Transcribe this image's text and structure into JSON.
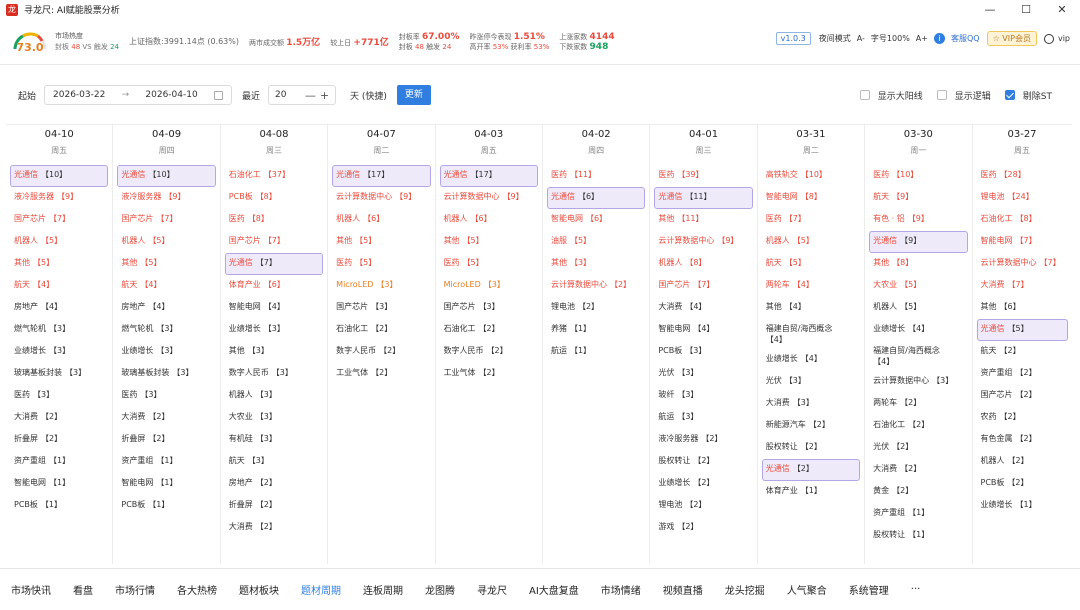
{
  "window": {
    "title": "寻龙尺: AI赋能股票分析",
    "logo": "龙",
    "min": "—",
    "max": "☐",
    "close": "✕"
  },
  "stats": {
    "gauge_value": "73.0",
    "heat_label": "市场热度",
    "heat_line": [
      "封板",
      "48",
      "VS",
      "触发",
      "24"
    ],
    "sh_label": "上证指数:3991.14点 (0.63%)",
    "vol_label": "两市成交额",
    "vol_value": "1.5万亿",
    "prev_label": "较上日",
    "prev_value": "+771亿",
    "seal_rate_label": "封板率",
    "seal_rate": "67.00%",
    "seal_count_label": "封板",
    "seal_count": "48",
    "touch_label": "触发",
    "touch_count": "24",
    "yest_label": "昨涨停今表现",
    "yest_value": "1.51%",
    "open_label": "高开率",
    "open_rate": "53%",
    "profit_label": "获利率",
    "profit_rate": "53%",
    "up_label": "上涨家数",
    "up_count": "4144",
    "down_label": "下跌家数",
    "down_count": "948"
  },
  "toolbar": {
    "version": "v1.0.3",
    "night": "夜间模式",
    "font_minus": "A-",
    "font_label": "字号100%",
    "font_plus": "A+",
    "info": "i",
    "qq": "客服QQ",
    "vip": "☆ VIP会员",
    "user": "vip"
  },
  "filter": {
    "start_label": "起始",
    "date_from": "2026-03-22",
    "arrow": "→",
    "date_to": "2026-04-10",
    "recent_label": "最近",
    "recent_value": "20",
    "minus": "—",
    "plus": "+",
    "days_label": "天 (快捷)",
    "update_btn": "更新",
    "opt_sun": "显示大阳线",
    "opt_logic": "显示逻辑",
    "opt_st": "剔除ST"
  },
  "colors": {
    "red": "#e84c3d",
    "orange": "#e67e22",
    "highlight": "#eeeaf9",
    "accent": "#2f7ee0"
  },
  "columns": [
    {
      "date": "04-10",
      "week": "周五",
      "items": [
        {
          "name": "光通信",
          "count": "【10】",
          "color": "red",
          "hl": true
        },
        {
          "name": "液冷服务器",
          "count": "【9】",
          "color": "red"
        },
        {
          "name": "国产芯片",
          "count": "【7】",
          "color": "red"
        },
        {
          "name": "机器人",
          "count": "【5】",
          "color": "red"
        },
        {
          "name": "其他",
          "count": "【5】",
          "color": "red"
        },
        {
          "name": "航天",
          "count": "【4】",
          "color": "red"
        },
        {
          "name": "房地产",
          "count": "【4】",
          "color": "blk"
        },
        {
          "name": "燃气轮机",
          "count": "【3】",
          "color": "blk"
        },
        {
          "name": "业绩增长",
          "count": "【3】",
          "color": "blk"
        },
        {
          "name": "玻璃基板封装",
          "count": "【3】",
          "color": "blk"
        },
        {
          "name": "医药",
          "count": "【3】",
          "color": "blk"
        },
        {
          "name": "大消费",
          "count": "【2】",
          "color": "blk"
        },
        {
          "name": "折叠屏",
          "count": "【2】",
          "color": "blk"
        },
        {
          "name": "资产重组",
          "count": "【1】",
          "color": "blk"
        },
        {
          "name": "智能电网",
          "count": "【1】",
          "color": "blk"
        },
        {
          "name": "PCB板",
          "count": "【1】",
          "color": "blk"
        }
      ]
    },
    {
      "date": "04-09",
      "week": "周四",
      "items": [
        {
          "name": "光通信",
          "count": "【10】",
          "color": "red",
          "hl": true
        },
        {
          "name": "液冷服务器",
          "count": "【9】",
          "color": "red"
        },
        {
          "name": "国产芯片",
          "count": "【7】",
          "color": "red"
        },
        {
          "name": "机器人",
          "count": "【5】",
          "color": "red"
        },
        {
          "name": "其他",
          "count": "【5】",
          "color": "red"
        },
        {
          "name": "航天",
          "count": "【4】",
          "color": "red"
        },
        {
          "name": "房地产",
          "count": "【4】",
          "color": "blk"
        },
        {
          "name": "燃气轮机",
          "count": "【3】",
          "color": "blk"
        },
        {
          "name": "业绩增长",
          "count": "【3】",
          "color": "blk"
        },
        {
          "name": "玻璃基板封装",
          "count": "【3】",
          "color": "blk"
        },
        {
          "name": "医药",
          "count": "【3】",
          "color": "blk"
        },
        {
          "name": "大消费",
          "count": "【2】",
          "color": "blk"
        },
        {
          "name": "折叠屏",
          "count": "【2】",
          "color": "blk"
        },
        {
          "name": "资产重组",
          "count": "【1】",
          "color": "blk"
        },
        {
          "name": "智能电网",
          "count": "【1】",
          "color": "blk"
        },
        {
          "name": "PCB板",
          "count": "【1】",
          "color": "blk"
        }
      ]
    },
    {
      "date": "04-08",
      "week": "周三",
      "items": [
        {
          "name": "石油化工",
          "count": "【37】",
          "color": "red"
        },
        {
          "name": "PCB板",
          "count": "【8】",
          "color": "red"
        },
        {
          "name": "医药",
          "count": "【8】",
          "color": "red"
        },
        {
          "name": "国产芯片",
          "count": "【7】",
          "color": "red"
        },
        {
          "name": "光通信",
          "count": "【7】",
          "color": "red",
          "hl": true
        },
        {
          "name": "体育产业",
          "count": "【6】",
          "color": "red"
        },
        {
          "name": "智能电网",
          "count": "【4】",
          "color": "blk"
        },
        {
          "name": "业绩增长",
          "count": "【3】",
          "color": "blk"
        },
        {
          "name": "其他",
          "count": "【3】",
          "color": "blk"
        },
        {
          "name": "数字人民币",
          "count": "【3】",
          "color": "blk"
        },
        {
          "name": "机器人",
          "count": "【3】",
          "color": "blk"
        },
        {
          "name": "大农业",
          "count": "【3】",
          "color": "blk"
        },
        {
          "name": "有机硅",
          "count": "【3】",
          "color": "blk"
        },
        {
          "name": "航天",
          "count": "【3】",
          "color": "blk"
        },
        {
          "name": "房地产",
          "count": "【2】",
          "color": "blk"
        },
        {
          "name": "折叠屏",
          "count": "【2】",
          "color": "blk"
        },
        {
          "name": "大消费",
          "count": "【2】",
          "color": "blk"
        }
      ]
    },
    {
      "date": "04-07",
      "week": "周二",
      "items": [
        {
          "name": "光通信",
          "count": "【17】",
          "color": "red",
          "hl": true
        },
        {
          "name": "云计算数据中心",
          "count": "【9】",
          "color": "red"
        },
        {
          "name": "机器人",
          "count": "【6】",
          "color": "red"
        },
        {
          "name": "其他",
          "count": "【5】",
          "color": "red"
        },
        {
          "name": "医药",
          "count": "【5】",
          "color": "red"
        },
        {
          "name": "MicroLED",
          "count": "【3】",
          "color": "org"
        },
        {
          "name": "国产芯片",
          "count": "【3】",
          "color": "blk"
        },
        {
          "name": "石油化工",
          "count": "【2】",
          "color": "blk"
        },
        {
          "name": "数字人民币",
          "count": "【2】",
          "color": "blk"
        },
        {
          "name": "工业气体",
          "count": "【2】",
          "color": "blk"
        }
      ]
    },
    {
      "date": "04-03",
      "week": "周五",
      "items": [
        {
          "name": "光通信",
          "count": "【17】",
          "color": "red",
          "hl": true
        },
        {
          "name": "云计算数据中心",
          "count": "【9】",
          "color": "red"
        },
        {
          "name": "机器人",
          "count": "【6】",
          "color": "red"
        },
        {
          "name": "其他",
          "count": "【5】",
          "color": "red"
        },
        {
          "name": "医药",
          "count": "【5】",
          "color": "red"
        },
        {
          "name": "MicroLED",
          "count": "【3】",
          "color": "org"
        },
        {
          "name": "国产芯片",
          "count": "【3】",
          "color": "blk"
        },
        {
          "name": "石油化工",
          "count": "【2】",
          "color": "blk"
        },
        {
          "name": "数字人民币",
          "count": "【2】",
          "color": "blk"
        },
        {
          "name": "工业气体",
          "count": "【2】",
          "color": "blk"
        }
      ]
    },
    {
      "date": "04-02",
      "week": "周四",
      "items": [
        {
          "name": "医药",
          "count": "【11】",
          "color": "red"
        },
        {
          "name": "光通信",
          "count": "【6】",
          "color": "red",
          "hl": true
        },
        {
          "name": "智能电网",
          "count": "【6】",
          "color": "red"
        },
        {
          "name": "油服",
          "count": "【5】",
          "color": "red"
        },
        {
          "name": "其他",
          "count": "【3】",
          "color": "red"
        },
        {
          "name": "云计算数据中心",
          "count": "【2】",
          "color": "red"
        },
        {
          "name": "锂电池",
          "count": "【2】",
          "color": "blk"
        },
        {
          "name": "养猪",
          "count": "【1】",
          "color": "blk"
        },
        {
          "name": "航运",
          "count": "【1】",
          "color": "blk"
        }
      ]
    },
    {
      "date": "04-01",
      "week": "周三",
      "items": [
        {
          "name": "医药",
          "count": "【39】",
          "color": "red"
        },
        {
          "name": "光通信",
          "count": "【11】",
          "color": "red",
          "hl": true
        },
        {
          "name": "其他",
          "count": "【11】",
          "color": "red"
        },
        {
          "name": "云计算数据中心",
          "count": "【9】",
          "color": "red"
        },
        {
          "name": "机器人",
          "count": "【8】",
          "color": "red"
        },
        {
          "name": "国产芯片",
          "count": "【7】",
          "color": "red"
        },
        {
          "name": "大消费",
          "count": "【4】",
          "color": "blk"
        },
        {
          "name": "智能电网",
          "count": "【4】",
          "color": "blk"
        },
        {
          "name": "PCB板",
          "count": "【3】",
          "color": "blk"
        },
        {
          "name": "光伏",
          "count": "【3】",
          "color": "blk"
        },
        {
          "name": "玻纤",
          "count": "【3】",
          "color": "blk"
        },
        {
          "name": "航运",
          "count": "【3】",
          "color": "blk"
        },
        {
          "name": "液冷服务器",
          "count": "【2】",
          "color": "blk"
        },
        {
          "name": "股权转让",
          "count": "【2】",
          "color": "blk"
        },
        {
          "name": "业绩增长",
          "count": "【2】",
          "color": "blk"
        },
        {
          "name": "锂电池",
          "count": "【2】",
          "color": "blk"
        },
        {
          "name": "游戏",
          "count": "【2】",
          "color": "blk"
        }
      ]
    },
    {
      "date": "03-31",
      "week": "周二",
      "items": [
        {
          "name": "高铁轨交",
          "count": "【10】",
          "color": "red"
        },
        {
          "name": "智能电网",
          "count": "【8】",
          "color": "red"
        },
        {
          "name": "医药",
          "count": "【7】",
          "color": "red"
        },
        {
          "name": "机器人",
          "count": "【5】",
          "color": "red"
        },
        {
          "name": "航天",
          "count": "【5】",
          "color": "red"
        },
        {
          "name": "两轮车",
          "count": "【4】",
          "color": "red"
        },
        {
          "name": "其他",
          "count": "【4】",
          "color": "blk"
        },
        {
          "name": "福建自贸/海西概念",
          "count": "【4】",
          "color": "blk",
          "tall": true
        },
        {
          "name": "业绩增长",
          "count": "【4】",
          "color": "blk"
        },
        {
          "name": "光伏",
          "count": "【3】",
          "color": "blk"
        },
        {
          "name": "大消费",
          "count": "【3】",
          "color": "blk"
        },
        {
          "name": "新能源汽车",
          "count": "【2】",
          "color": "blk"
        },
        {
          "name": "股权转让",
          "count": "【2】",
          "color": "blk"
        },
        {
          "name": "光通信",
          "count": "【2】",
          "color": "blk",
          "hl": true
        },
        {
          "name": "体育产业",
          "count": "【1】",
          "color": "blk"
        }
      ]
    },
    {
      "date": "03-30",
      "week": "周一",
      "items": [
        {
          "name": "医药",
          "count": "【10】",
          "color": "red"
        },
        {
          "name": "航天",
          "count": "【9】",
          "color": "red"
        },
        {
          "name": "有色 · 铝",
          "count": "【9】",
          "color": "red"
        },
        {
          "name": "光通信",
          "count": "【9】",
          "color": "red",
          "hl": true
        },
        {
          "name": "其他",
          "count": "【8】",
          "color": "red"
        },
        {
          "name": "大农业",
          "count": "【5】",
          "color": "red"
        },
        {
          "name": "机器人",
          "count": "【5】",
          "color": "blk"
        },
        {
          "name": "业绩增长",
          "count": "【4】",
          "color": "blk"
        },
        {
          "name": "福建自贸/海西概念",
          "count": "【4】",
          "color": "blk",
          "tall": true
        },
        {
          "name": "云计算数据中心",
          "count": "【3】",
          "color": "blk"
        },
        {
          "name": "两轮车",
          "count": "【2】",
          "color": "blk"
        },
        {
          "name": "石油化工",
          "count": "【2】",
          "color": "blk"
        },
        {
          "name": "光伏",
          "count": "【2】",
          "color": "blk"
        },
        {
          "name": "大消费",
          "count": "【2】",
          "color": "blk"
        },
        {
          "name": "黄金",
          "count": "【2】",
          "color": "blk"
        },
        {
          "name": "资产重组",
          "count": "【1】",
          "color": "blk"
        },
        {
          "name": "股权转让",
          "count": "【1】",
          "color": "blk"
        }
      ]
    },
    {
      "date": "03-27",
      "week": "周五",
      "items": [
        {
          "name": "医药",
          "count": "【28】",
          "color": "red"
        },
        {
          "name": "锂电池",
          "count": "【24】",
          "color": "red"
        },
        {
          "name": "石油化工",
          "count": "【8】",
          "color": "red"
        },
        {
          "name": "智能电网",
          "count": "【7】",
          "color": "red"
        },
        {
          "name": "云计算数据中心",
          "count": "【7】",
          "color": "red"
        },
        {
          "name": "大消费",
          "count": "【7】",
          "color": "red"
        },
        {
          "name": "其他",
          "count": "【6】",
          "color": "blk"
        },
        {
          "name": "光通信",
          "count": "【5】",
          "color": "blk",
          "hl": true
        },
        {
          "name": "航天",
          "count": "【2】",
          "color": "blk"
        },
        {
          "name": "资产重组",
          "count": "【2】",
          "color": "blk"
        },
        {
          "name": "国产芯片",
          "count": "【2】",
          "color": "blk"
        },
        {
          "name": "农药",
          "count": "【2】",
          "color": "blk"
        },
        {
          "name": "有色金属",
          "count": "【2】",
          "color": "blk"
        },
        {
          "name": "机器人",
          "count": "【2】",
          "color": "blk"
        },
        {
          "name": "PCB板",
          "count": "【2】",
          "color": "blk"
        },
        {
          "name": "业绩增长",
          "count": "【1】",
          "color": "blk"
        }
      ]
    }
  ],
  "nav": [
    "市场快讯",
    "看盘",
    "市场行情",
    "各大热榜",
    "题材板块",
    "题材周期",
    "连板周期",
    "龙图腾",
    "寻龙尺",
    "AI大盘复盘",
    "市场情绪",
    "视频直播",
    "龙头挖掘",
    "人气聚合",
    "系统管理",
    "···"
  ],
  "nav_active": "题材周期"
}
